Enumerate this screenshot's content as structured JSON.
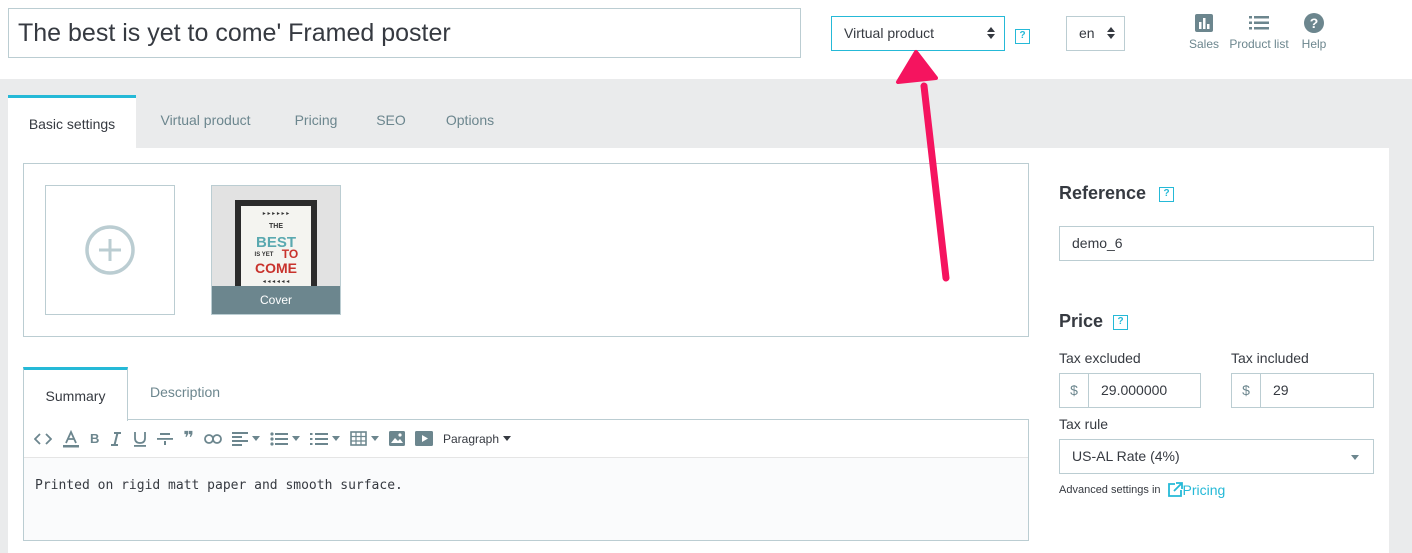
{
  "product": {
    "name": "The best is yet to come' Framed poster",
    "type": "Virtual product",
    "language": "en"
  },
  "quick_links": [
    {
      "label": "Sales",
      "icon": "bar-chart-icon"
    },
    {
      "label": "Product list",
      "icon": "list-icon"
    },
    {
      "label": "Help",
      "icon": "help-circle-icon"
    }
  ],
  "tabs": [
    {
      "label": "Basic settings",
      "active": true
    },
    {
      "label": "Virtual product"
    },
    {
      "label": "Pricing"
    },
    {
      "label": "SEO"
    },
    {
      "label": "Options"
    }
  ],
  "images": {
    "cover_label": "Cover",
    "poster_lines": [
      "THE",
      "BEST",
      "IS YET",
      "TO",
      "COME"
    ]
  },
  "editor": {
    "tabs": [
      {
        "label": "Summary",
        "active": true
      },
      {
        "label": "Description"
      }
    ],
    "paragraph_label": "Paragraph",
    "content": "Printed on rigid matt paper and smooth surface."
  },
  "reference": {
    "title": "Reference",
    "value": "demo_6"
  },
  "price": {
    "title": "Price",
    "tax_excluded_label": "Tax excluded",
    "tax_included_label": "Tax included",
    "currency": "$",
    "tax_excluded_value": "29.000000",
    "tax_included_value": "29",
    "tax_rule_label": "Tax rule",
    "tax_rule_value": "US-AL Rate (4%)",
    "advanced_text": "Advanced settings in",
    "advanced_link": "Pricing"
  },
  "help_mark": "?",
  "colors": {
    "accent": "#25b9d7",
    "arrow": "#f5145f",
    "border": "#bbcdd2",
    "muted": "#6c868e"
  }
}
